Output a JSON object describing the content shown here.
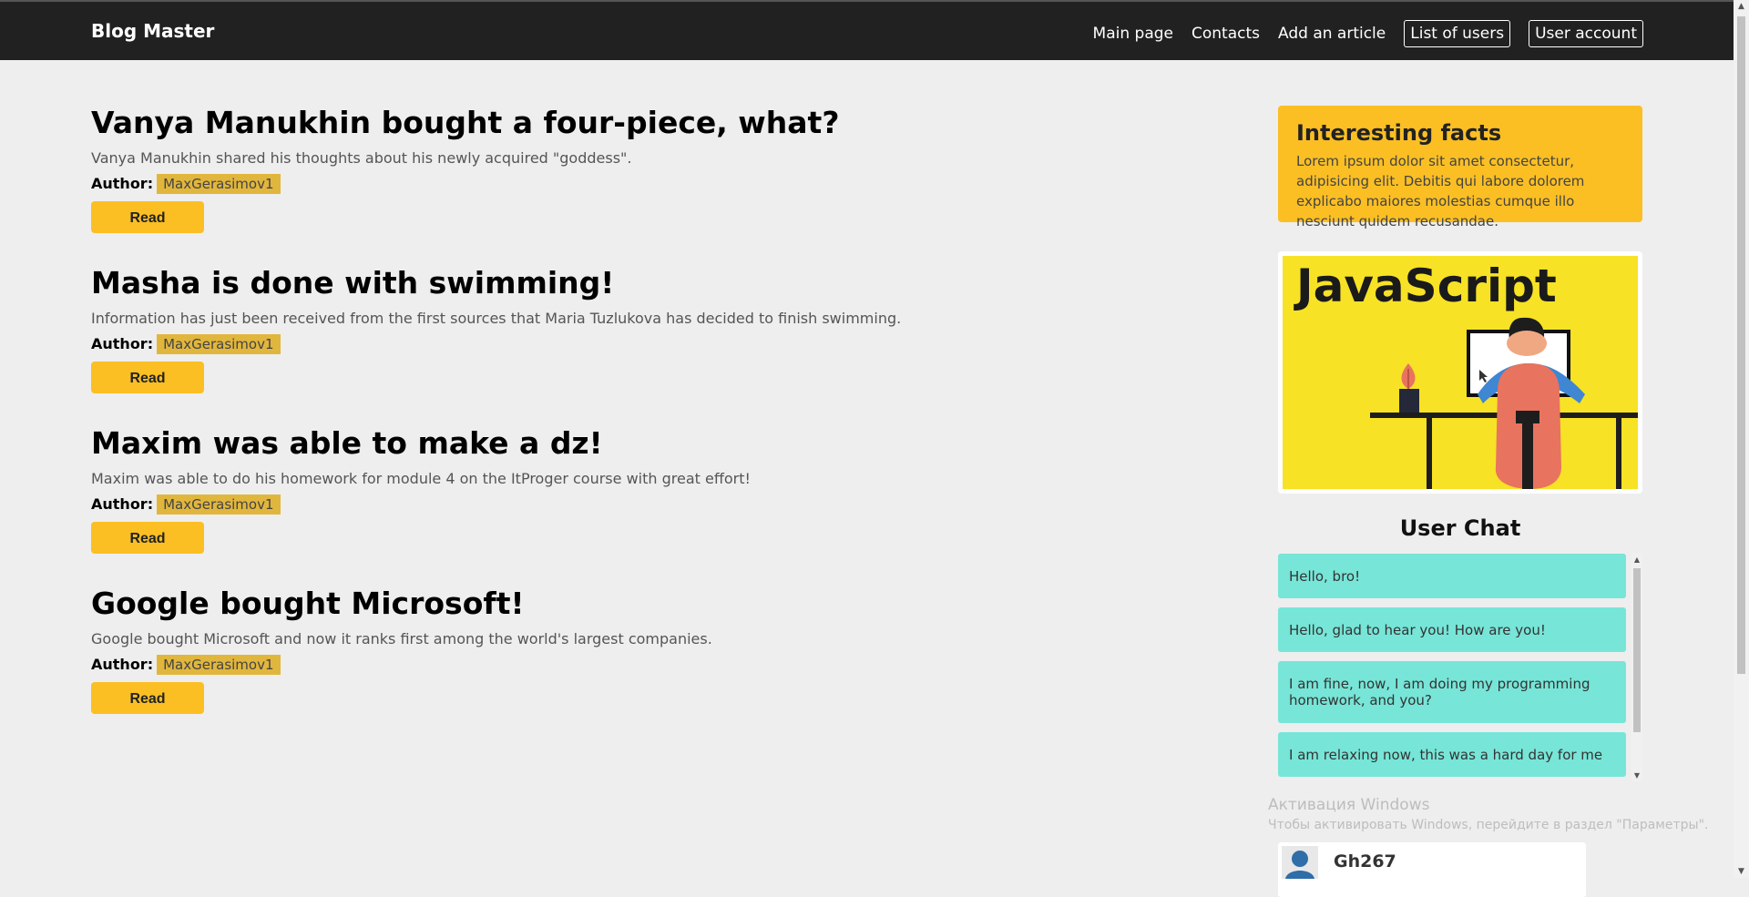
{
  "header": {
    "brand": "Blog Master",
    "nav": [
      "Main page",
      "Contacts",
      "Add an article",
      "List of users",
      "User account"
    ]
  },
  "posts": [
    {
      "title": "Vanya Manukhin bought a four-piece, what?",
      "description": "Vanya Manukhin shared his thoughts about his newly acquired \"goddess\".",
      "author_label": "Author:",
      "author": "MaxGerasimov1",
      "button": "Read"
    },
    {
      "title": "Masha is done with swimming!",
      "description": "Information has just been received from the first sources that Maria Tuzlukova has decided to finish swimming.",
      "author_label": "Author:",
      "author": "MaxGerasimov1",
      "button": "Read"
    },
    {
      "title": "Maxim was able to make a dz!",
      "description": "Maxim was able to do his homework for module 4 on the ItProger course with great effort!",
      "author_label": "Author:",
      "author": "MaxGerasimov1",
      "button": "Read"
    },
    {
      "title": "Google bought Microsoft!",
      "description": "Google bought Microsoft and now it ranks first among the world's largest companies.",
      "author_label": "Author:",
      "author": "MaxGerasimov1",
      "button": "Read"
    }
  ],
  "sidebar": {
    "facts_title": "Interesting facts",
    "facts_text": "Lorem ipsum dolor sit amet consectetur, adipisicing elit. Debitis qui labore dolorem explicabo maiores molestias cumque illo nesciunt quidem recusandae.",
    "banner_text": "JavaScript",
    "chat_title": "User Chat",
    "messages": [
      "Hello, bro!",
      "Hello, glad to hear you! How are you!",
      "I am fine, now, I am doing my programming homework, and you?",
      "I am relaxing now, this was a hard day for me"
    ],
    "profile_name": "Gh267"
  },
  "watermark": {
    "line1": "Активация Windows",
    "line2": "Чтобы активировать Windows, перейдите в раздел \"Параметры\"."
  },
  "colors": {
    "accent": "#fbbf24",
    "header_bg": "#212121",
    "chat_bubble": "#77e5d7",
    "author_tag": "#e1b63d"
  }
}
